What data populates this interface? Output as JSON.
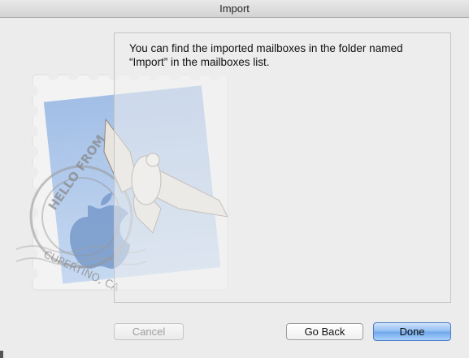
{
  "window": {
    "title": "Import"
  },
  "message": {
    "text": "You can find the imported mailboxes in the folder named “Import” in the mailboxes list."
  },
  "stamp": {
    "postmark_text_top": "HELLO FROM",
    "postmark_text_bottom": "CUPERTINO, CA",
    "icon": "mail-stamp-eagle-icon"
  },
  "buttons": {
    "cancel_label": "Cancel",
    "go_back_label": "Go Back",
    "done_label": "Done"
  },
  "colors": {
    "window_bg": "#ececec",
    "stamp_blue": "#9fbfe6",
    "done_button": "#7aaff0"
  }
}
